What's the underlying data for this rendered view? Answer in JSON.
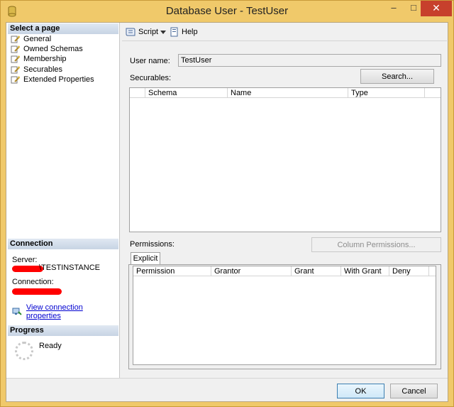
{
  "window": {
    "title": "Database User - TestUser",
    "minimize_glyph": "–",
    "maximize_glyph": "□",
    "close_glyph": "✕"
  },
  "left_pane": {
    "select_header": "Select a page",
    "pages": [
      {
        "label": "General",
        "icon": "wrench-page-icon"
      },
      {
        "label": "Owned Schemas",
        "icon": "wrench-page-icon"
      },
      {
        "label": "Membership",
        "icon": "wrench-page-icon"
      },
      {
        "label": "Securables",
        "icon": "wrench-page-icon"
      },
      {
        "label": "Extended Properties",
        "icon": "wrench-page-icon"
      }
    ],
    "connection_header": "Connection",
    "server_label": "Server:",
    "server_value": "\\TESTINSTANCE",
    "connection_label": "Connection:",
    "view_connection_link": "View connection properties",
    "progress_header": "Progress",
    "progress_status": "Ready"
  },
  "toolbar": {
    "script_label": "Script",
    "help_label": "Help"
  },
  "form": {
    "user_name_label": "User name:",
    "user_name_value": "TestUser",
    "securables_label": "Securables:",
    "search_button": "Search...",
    "securables_columns": [
      "Schema",
      "Name",
      "Type"
    ],
    "permissions_label": "Permissions:",
    "column_permissions_button": "Column Permissions...",
    "explicit_tab": "Explicit",
    "permissions_columns": [
      "Permission",
      "Grantor",
      "Grant",
      "With Grant",
      "Deny"
    ]
  },
  "footer": {
    "ok_button": "OK",
    "cancel_button": "Cancel"
  },
  "colors": {
    "titlebar": "#f0c96a",
    "close_button": "#c7402c",
    "link": "#0000d0",
    "redaction": "#ff0000"
  }
}
